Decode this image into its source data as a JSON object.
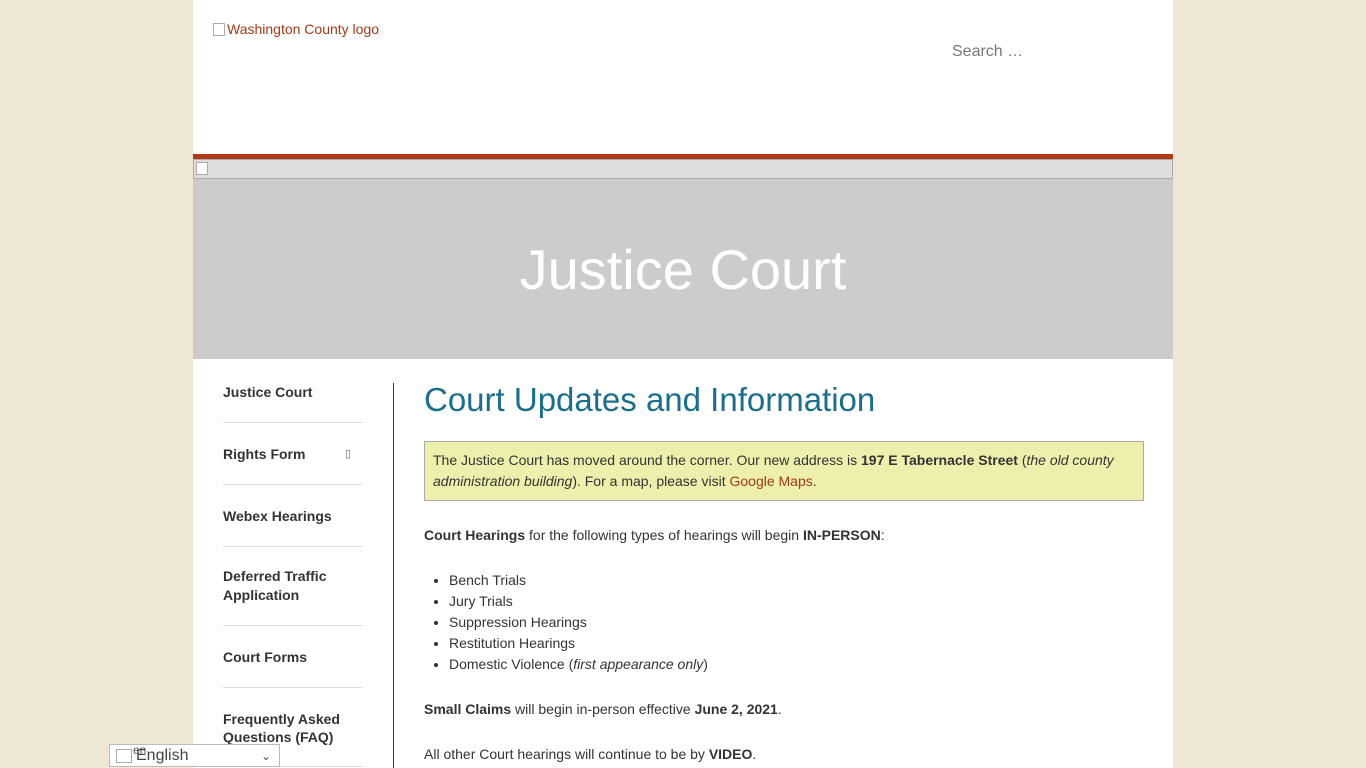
{
  "header": {
    "logo_alt": "Washington County logo",
    "search_placeholder": "Search …"
  },
  "hero": {
    "title": "Justice Court"
  },
  "sidebar": {
    "items": [
      {
        "label": "Justice Court"
      },
      {
        "label": "Rights Form",
        "toggle": "▯"
      },
      {
        "label": "Webex Hearings"
      },
      {
        "label": "Deferred Traffic Application"
      },
      {
        "label": "Court Forms"
      },
      {
        "label": "Frequently Asked Questions (FAQ)"
      }
    ]
  },
  "content": {
    "heading": "Court Updates and Information",
    "notice": {
      "part1": "The Justice Court has moved around the corner. Our new address is ",
      "address": "197 E Tabernacle Street",
      "part2": " (",
      "building": "the old county administration building",
      "part3": "). For a map, please visit ",
      "map_link": "Google Maps",
      "part4": "."
    },
    "hearings_intro": {
      "bold1": "Court Hearings",
      "text1": " for the following types of hearings will begin ",
      "bold2": "IN-PERSON",
      "text2": ":"
    },
    "hearings": [
      "Bench Trials",
      "Jury Trials",
      "Suppression Hearings",
      "Restitution Hearings"
    ],
    "dv": {
      "label": "Domestic Violence (",
      "italic": "first appearance only",
      "close": ")"
    },
    "small_claims": {
      "bold1": "Small Claims",
      "text1": " will begin in-person effective ",
      "bold2": "June 2, 2021",
      "text2": "."
    },
    "other": {
      "text1": "All other Court hearings will continue to be by ",
      "bold": "VIDEO",
      "text2": "."
    }
  },
  "language": {
    "flag_code": "en",
    "label": "English",
    "chevron": "⌄"
  }
}
